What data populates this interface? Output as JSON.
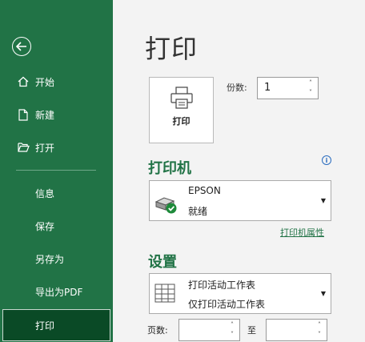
{
  "sidebar": {
    "items": [
      {
        "label": "开始"
      },
      {
        "label": "新建"
      },
      {
        "label": "打开"
      },
      {
        "label": "信息"
      },
      {
        "label": "保存"
      },
      {
        "label": "另存为"
      },
      {
        "label": "导出为PDF"
      },
      {
        "label": "打印"
      }
    ],
    "active_index": 7
  },
  "main": {
    "title": "打印",
    "print_button_label": "打印",
    "copies": {
      "label": "份数:",
      "value": "1"
    },
    "printer_section": {
      "title": "打印机",
      "printer_name": "EPSON",
      "printer_status": "就绪",
      "properties_link": "打印机属性"
    },
    "settings_section": {
      "title": "设置",
      "scope_line1": "打印活动工作表",
      "scope_line2": "仅打印活动工作表"
    },
    "pages": {
      "label": "页数:",
      "to_label": "至",
      "from_value": "",
      "to_value": ""
    }
  },
  "colors": {
    "accent": "#217346",
    "active_bg": "#0a4a26",
    "link": "#217346",
    "info": "#2a6cbf"
  }
}
